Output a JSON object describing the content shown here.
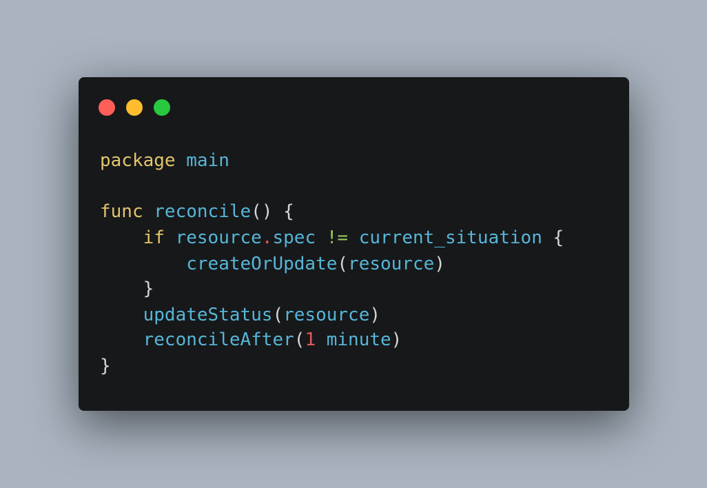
{
  "colors": {
    "background": "#a9b4c0",
    "window": "#17181a",
    "close_dot": "#ff5f57",
    "minimize_dot": "#febc2e",
    "zoom_dot": "#28c840",
    "keyword": "#e3c56b",
    "identifier": "#56b6d8",
    "operator": "#9bc95c",
    "number": "#e05a5a",
    "punctuation": "#d6d7d9"
  },
  "window_controls": [
    "close",
    "minimize",
    "zoom"
  ],
  "code": {
    "language": "go",
    "line1": {
      "kw": "package",
      "name": "main"
    },
    "line2": {
      "kw": "func",
      "name": "reconcile",
      "paren": "()",
      "brace": "{"
    },
    "line3": {
      "kw": "if",
      "obj": "resource",
      "dot": ".",
      "field": "spec",
      "op": "!=",
      "rhs": "current_situation",
      "brace": "{"
    },
    "line4": {
      "fn": "createOrUpdate",
      "open": "(",
      "arg": "resource",
      "close": ")"
    },
    "line5": {
      "brace": "}"
    },
    "line6": {
      "fn": "updateStatus",
      "open": "(",
      "arg": "resource",
      "close": ")"
    },
    "line7": {
      "fn": "reconcileAfter",
      "open": "(",
      "num": "1",
      "unit": "minute",
      "close": ")"
    },
    "line8": {
      "brace": "}"
    }
  }
}
